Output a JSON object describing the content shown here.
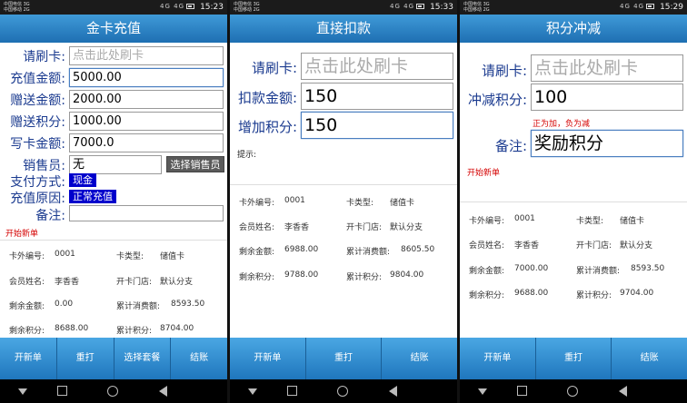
{
  "status": {
    "carrier1": "中国电信 3G",
    "carrier2": "中国移动 2G",
    "signal": "4G 4G",
    "times": [
      "15:23",
      "15:33",
      "15:29"
    ]
  },
  "screen1": {
    "title": "金卡充值",
    "fields": [
      {
        "label": "请刷卡:",
        "value": "",
        "placeholder": "点击此处刷卡"
      },
      {
        "label": "充值金额:",
        "value": "5000.00"
      },
      {
        "label": "赠送金额:",
        "value": "2000.00"
      },
      {
        "label": "赠送积分:",
        "value": "1000.00"
      },
      {
        "label": "写卡金额:",
        "value": "7000.0"
      }
    ],
    "seller_label": "销售员:",
    "seller_value": "无",
    "seller_button": "选择销售员",
    "payment_label": "支付方式:",
    "payment_value": "现金",
    "reason_label": "充值原因:",
    "reason_value": "正常充值",
    "remark_label": "备注:",
    "remark_value": "",
    "new_order": "开始新单",
    "info": [
      [
        "卡外编号:",
        "0001",
        "卡类型:",
        "储值卡"
      ],
      [
        "会员姓名:",
        "李香香",
        "开卡门店:",
        "默认分支"
      ],
      [
        "剩余金额:",
        "0.00",
        "累计消费额:",
        "8593.50"
      ],
      [
        "剩余积分:",
        "8688.00",
        "累计积分:",
        "8704.00"
      ]
    ],
    "buttons": [
      "开新单",
      "重打",
      "选择套餐",
      "结账"
    ]
  },
  "screen2": {
    "title": "直接扣款",
    "fields": [
      {
        "label": "请刷卡:",
        "value": "",
        "placeholder": "点击此处刷卡"
      },
      {
        "label": "扣款金额:",
        "value": "150"
      },
      {
        "label": "增加积分:",
        "value": "150"
      }
    ],
    "hint": "提示:",
    "info": [
      [
        "卡外编号:",
        "0001",
        "卡类型:",
        "储值卡"
      ],
      [
        "会员姓名:",
        "李香香",
        "开卡门店:",
        "默认分支"
      ],
      [
        "剩余金额:",
        "6988.00",
        "累计消费额:",
        "8605.50"
      ],
      [
        "剩余积分:",
        "9788.00",
        "累计积分:",
        "9804.00"
      ]
    ],
    "buttons": [
      "开新单",
      "重打",
      "结账"
    ]
  },
  "screen3": {
    "title": "积分冲减",
    "fields": [
      {
        "label": "请刷卡:",
        "value": "",
        "placeholder": "点击此处刷卡"
      },
      {
        "label": "冲减积分:",
        "value": "100"
      }
    ],
    "note": "正为加，负为减",
    "remark_label": "备注:",
    "remark_value": "奖励积分",
    "new_order": "开始新单",
    "info": [
      [
        "卡外编号:",
        "0001",
        "卡类型:",
        "储值卡"
      ],
      [
        "会员姓名:",
        "李香香",
        "开卡门店:",
        "默认分支"
      ],
      [
        "剩余金额:",
        "7000.00",
        "累计消费额:",
        "8593.50"
      ],
      [
        "剩余积分:",
        "9688.00",
        "累计积分:",
        "9704.00"
      ]
    ],
    "buttons": [
      "开新单",
      "重打",
      "结账"
    ]
  },
  "colors": {
    "titlebar": "#1e6fb2",
    "label": "#1a3a8f",
    "red": "#d40000",
    "badge": "#0000cc"
  }
}
